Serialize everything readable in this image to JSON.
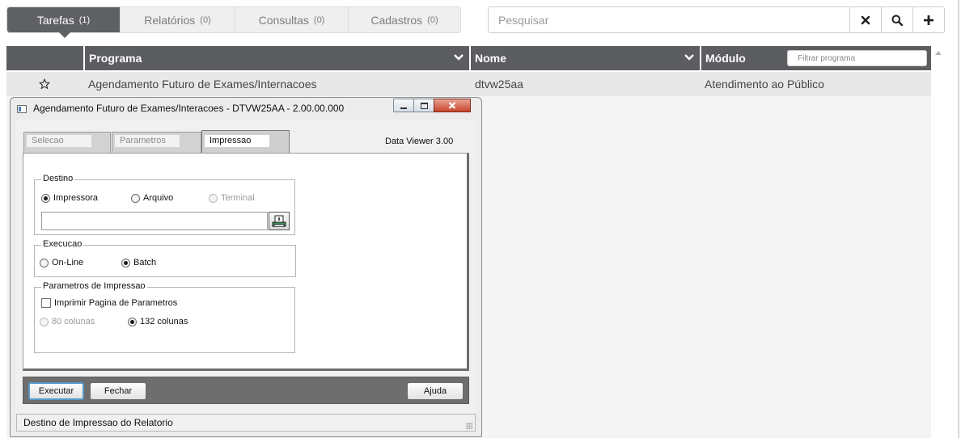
{
  "top_tabs": [
    {
      "label": "Tarefas",
      "count": "(1)"
    },
    {
      "label": "Relatórios",
      "count": "(0)"
    },
    {
      "label": "Consultas",
      "count": "(0)"
    },
    {
      "label": "Cadastros",
      "count": "(0)"
    }
  ],
  "search": {
    "placeholder": "Pesquisar",
    "icons": [
      "close-icon",
      "search-icon",
      "plus-icon"
    ]
  },
  "grid": {
    "columns": {
      "programa": "Programa",
      "nome": "Nome",
      "modulo": "Módulo"
    },
    "filter_placeholder": "Filtrar programa",
    "rows": [
      {
        "favorite_icon": "star-outline-icon",
        "programa": "Agendamento Futuro de Exames/Internacoes",
        "nome": "dtvw25aa",
        "modulo": "Atendimento ao Público"
      }
    ]
  },
  "dialog": {
    "title": "Agendamento Futuro de Exames/Interacoes - DTVW25AA - 2.00.00.000",
    "tabs": [
      "Selecao",
      "Parametros",
      "Impressao"
    ],
    "active_tab": "Impressao",
    "data_viewer": "Data Viewer 3.00",
    "destino": {
      "title": "Destino",
      "options": [
        "Impressora",
        "Arquivo",
        "Terminal"
      ],
      "selected": "Impressora",
      "disabled": [
        "Terminal"
      ],
      "path_value": ""
    },
    "execucao": {
      "title": "Execucao",
      "options": [
        "On-Line",
        "Batch"
      ],
      "selected": "Batch"
    },
    "parametros": {
      "title": "Parametros de Impressao",
      "checkbox_label": "Imprimir Pagina de Parametros",
      "checkbox_checked": false,
      "options": [
        "80 colunas",
        "132 colunas"
      ],
      "selected": "132 colunas",
      "disabled": [
        "80 colunas"
      ]
    },
    "buttons": {
      "executar": "Executar",
      "fechar": "Fechar",
      "ajuda": "Ajuda"
    },
    "status": "Destino de Impressao do Relatorio"
  }
}
